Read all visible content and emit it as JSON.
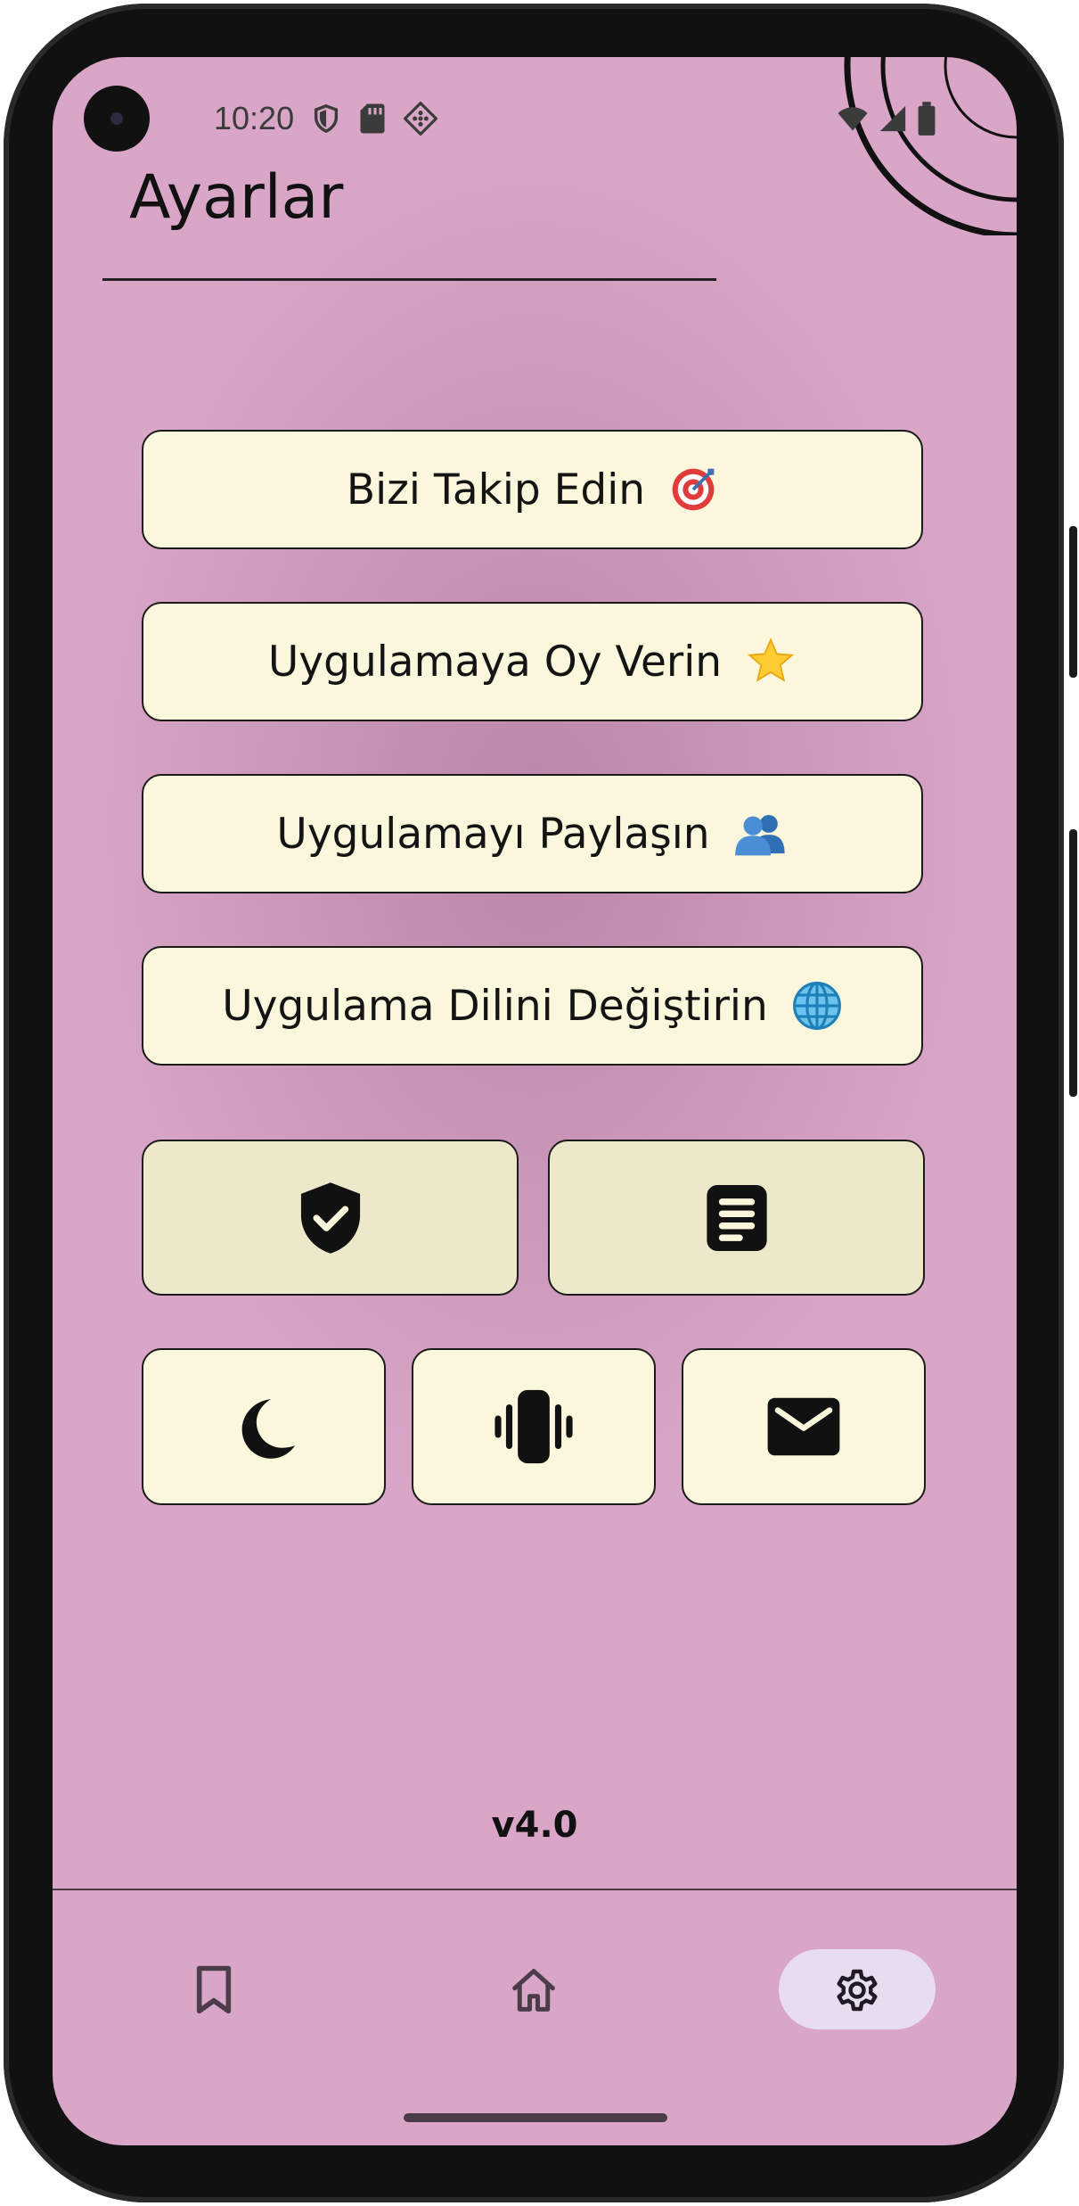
{
  "status_bar": {
    "time": "10:20",
    "icons_left": [
      "shield-icon",
      "sd-card-icon",
      "diamond-grid-icon"
    ],
    "icons_right": [
      "wifi-icon",
      "signal-icon",
      "battery-icon"
    ]
  },
  "header": {
    "title": "Ayarlar"
  },
  "menu": {
    "items": [
      {
        "label": "Bizi Takip Edin",
        "icon": "target-icon"
      },
      {
        "label": "Uygulamaya Oy Verin",
        "icon": "star-icon"
      },
      {
        "label": "Uygulamayı Paylaşın",
        "icon": "people-icon"
      },
      {
        "label": "Uygulama Dilini Değiştirin",
        "icon": "globe-icon"
      }
    ]
  },
  "icon_buttons_row1": [
    {
      "icon": "shield-check-icon"
    },
    {
      "icon": "document-icon"
    }
  ],
  "icon_buttons_row2": [
    {
      "icon": "moon-icon"
    },
    {
      "icon": "vibrate-icon"
    },
    {
      "icon": "mail-icon"
    }
  ],
  "footer": {
    "version": "v4.0"
  },
  "bottom_nav": {
    "items": [
      {
        "icon": "bookmark-icon",
        "active": false
      },
      {
        "icon": "home-icon",
        "active": false
      },
      {
        "icon": "settings-gear-icon",
        "active": true
      }
    ]
  },
  "colors": {
    "background": "#d9a6c8",
    "button": "#fbf7dc",
    "button_tinted": "#ece8c9",
    "nav_active_pill": "#e8dcf1",
    "text": "#141414"
  }
}
